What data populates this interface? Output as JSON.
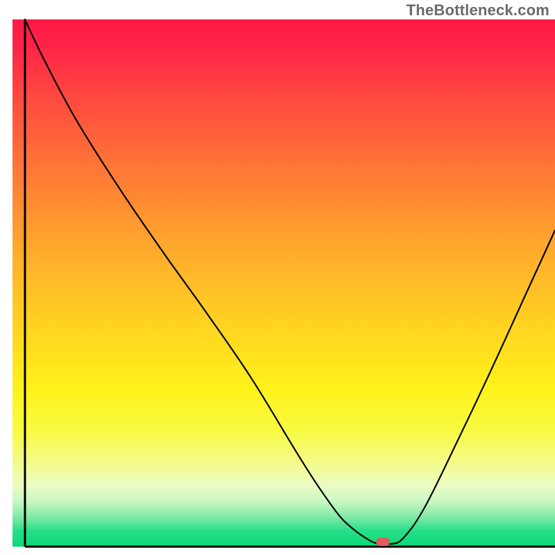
{
  "watermark": "TheBottleneck.com",
  "chart_data": {
    "type": "line",
    "title": "",
    "xlabel": "",
    "ylabel": "",
    "xlim": [
      0,
      100
    ],
    "ylim": [
      0,
      100
    ],
    "background_gradient": {
      "stops": [
        {
          "offset": 0.0,
          "color": "#ff1a47"
        },
        {
          "offset": 0.05,
          "color": "#ff2347"
        },
        {
          "offset": 0.15,
          "color": "#ff4a3f"
        },
        {
          "offset": 0.3,
          "color": "#ff7c35"
        },
        {
          "offset": 0.45,
          "color": "#ffae2b"
        },
        {
          "offset": 0.58,
          "color": "#ffd321"
        },
        {
          "offset": 0.7,
          "color": "#fff219"
        },
        {
          "offset": 0.78,
          "color": "#f8fb42"
        },
        {
          "offset": 0.84,
          "color": "#f4fb8a"
        },
        {
          "offset": 0.885,
          "color": "#eafcc5"
        },
        {
          "offset": 0.915,
          "color": "#c8f7c3"
        },
        {
          "offset": 0.945,
          "color": "#7de9a6"
        },
        {
          "offset": 0.97,
          "color": "#26df88"
        },
        {
          "offset": 1.0,
          "color": "#0bd977"
        }
      ]
    },
    "series": [
      {
        "name": "bottleneck-curve",
        "color": "#000000",
        "width": 2.2,
        "x": [
          2.3,
          6,
          12,
          20,
          28,
          36,
          44,
          52,
          56,
          60,
          62.5,
          65,
          67.2,
          69.5,
          72,
          76,
          82,
          88,
          94,
          100
        ],
        "y": [
          100,
          92,
          80.5,
          67.5,
          55.5,
          44,
          32,
          18.5,
          12,
          6.2,
          3.6,
          1.7,
          0.6,
          0.5,
          1.6,
          7.5,
          20,
          33,
          46.5,
          60
        ]
      }
    ],
    "marker": {
      "name": "optimal-point",
      "x": 68.3,
      "y": 0.9,
      "color": "#e15a5a",
      "rx": 10,
      "ry": 6
    },
    "axes": {
      "left": {
        "x": 2.3,
        "y0": 0,
        "y1": 100
      },
      "bottom": {
        "y": 0,
        "x0": 2.3,
        "x1": 100
      }
    }
  }
}
